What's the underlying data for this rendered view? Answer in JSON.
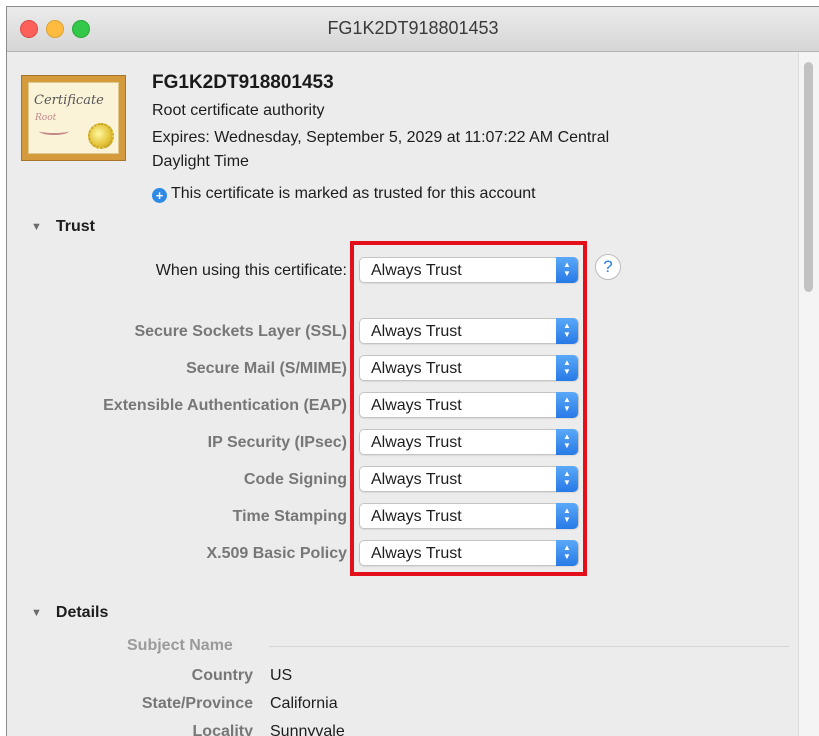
{
  "window": {
    "title": "FG1K2DT918801453"
  },
  "certificate": {
    "icon_text": "Certificate",
    "icon_subtext": "Root",
    "name": "FG1K2DT918801453",
    "kind": "Root certificate authority",
    "expires_line1": "Expires: Wednesday, September 5, 2029 at 11:07:22 AM Central",
    "expires_line2": "Daylight Time",
    "trusted_note": "This certificate is marked as trusted for this account"
  },
  "trust": {
    "section_title": "Trust",
    "main_label": "When using this certificate:",
    "main_value": "Always Trust",
    "help_label": "?",
    "rows": [
      {
        "label": "Secure Sockets Layer (SSL)",
        "value": "Always Trust"
      },
      {
        "label": "Secure Mail (S/MIME)",
        "value": "Always Trust"
      },
      {
        "label": "Extensible Authentication (EAP)",
        "value": "Always Trust"
      },
      {
        "label": "IP Security (IPsec)",
        "value": "Always Trust"
      },
      {
        "label": "Code Signing",
        "value": "Always Trust"
      },
      {
        "label": "Time Stamping",
        "value": "Always Trust"
      },
      {
        "label": "X.509 Basic Policy",
        "value": "Always Trust"
      }
    ]
  },
  "details": {
    "section_title": "Details",
    "subject_heading": "Subject Name",
    "rows": [
      {
        "label": "Country",
        "value": "US"
      },
      {
        "label": "State/Province",
        "value": "California"
      },
      {
        "label": "Locality",
        "value": "Sunnyvale"
      }
    ]
  },
  "colors": {
    "highlight": "#e3101b",
    "popup_accent": "#2779e6",
    "info_icon": "#2f8ae5"
  },
  "icons": {
    "disclosure": "disclosure-triangle-icon",
    "popup_arrows": "up-down-chevron-icon",
    "info": "info-plus-icon"
  }
}
